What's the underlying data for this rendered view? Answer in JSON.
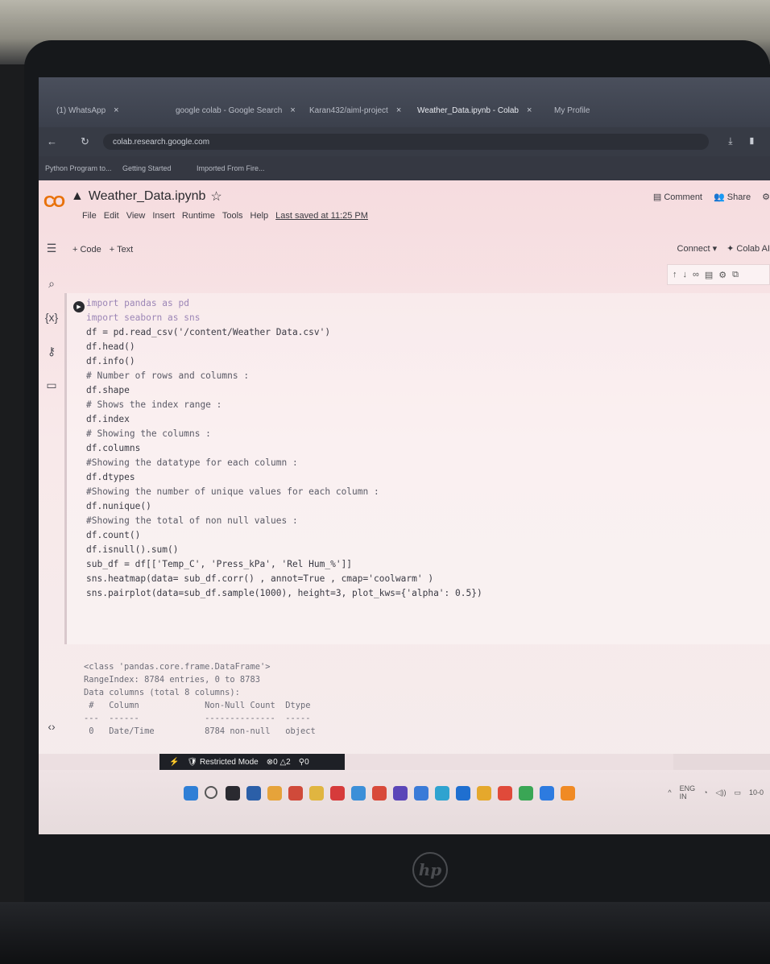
{
  "browser": {
    "tabs": [
      {
        "label": "(1) WhatsApp"
      },
      {
        "label": "google colab - Google Search"
      },
      {
        "label": "Karan432/aiml-project"
      },
      {
        "label": "Weather_Data.ipynb - Colab",
        "active": true
      },
      {
        "label": "My Profile"
      }
    ],
    "url": "colab.research.google.com",
    "bookmarks": [
      "Python Program to...",
      "Getting Started",
      "Imported From Fire..."
    ]
  },
  "notebook": {
    "title": "Weather_Data.ipynb",
    "menu": [
      "File",
      "Edit",
      "View",
      "Insert",
      "Runtime",
      "Tools",
      "Help"
    ],
    "last_saved": "Last saved at 11:25 PM",
    "comment": "Comment",
    "share": "Share",
    "add_code": "+ Code",
    "add_text": "+ Text",
    "connect": "Connect",
    "colab_ai": "Colab AI"
  },
  "code_lines": [
    "import pandas as pd",
    "import seaborn as sns",
    "df = pd.read_csv('/content/Weather Data.csv')",
    "df.head()",
    "df.info()",
    "# Number of rows and columns :",
    "df.shape",
    "# Shows the index range :",
    "df.index",
    "# Showing the columns :",
    "df.columns",
    "#Showing the datatype for each column :",
    "df.dtypes",
    "#Showing the number of unique values for each column :",
    "df.nunique()",
    "#Showing the total of non null values :",
    "df.count()",
    "df.isnull().sum()",
    "sub_df = df[['Temp_C', 'Press_kPa', 'Rel Hum_%']]",
    "sns.heatmap(data= sub_df.corr() , annot=True , cmap='coolwarm' )",
    "sns.pairplot(data=sub_df.sample(1000), height=3, plot_kws={'alpha': 0.5})"
  ],
  "output_lines": [
    "<class 'pandas.core.frame.DataFrame'>",
    "RangeIndex: 8784 entries, 0 to 8783",
    "Data columns (total 8 columns):",
    " #   Column             Non-Null Count  Dtype",
    "---  ------             --------------  -----",
    " 0   Date/Time          8784 non-null   object"
  ],
  "statusbar": {
    "restricted_mode": "Restricted Mode",
    "errors": "0",
    "warnings": "2",
    "ports": "0"
  },
  "tray": {
    "lang": "ENG",
    "region": "IN",
    "date": "10-0"
  },
  "colors": {
    "colab_orange": "#e8710a",
    "string": "#b36a4e",
    "keyword": "#9c86b6"
  }
}
